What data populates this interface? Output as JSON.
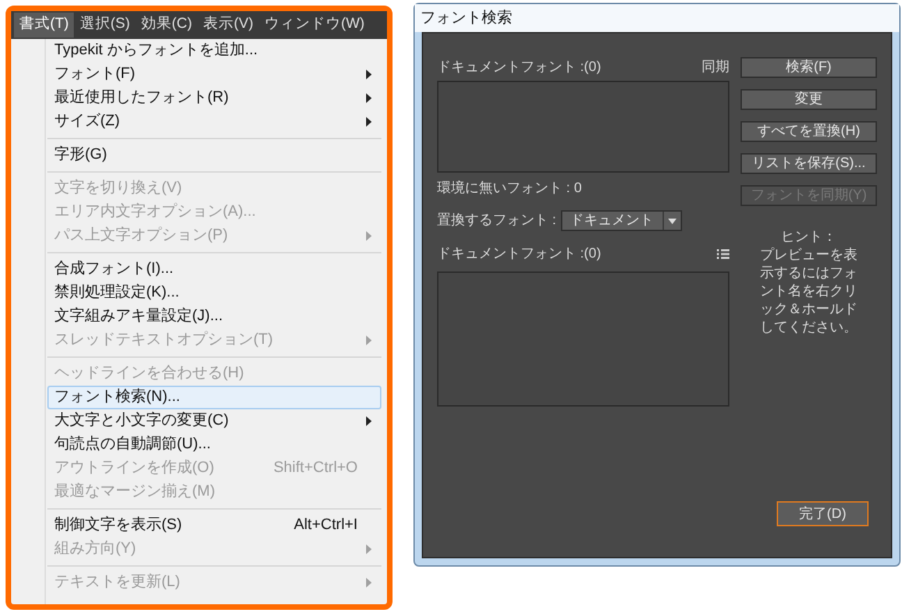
{
  "menu_bar": [
    {
      "label": "書式(T)",
      "selected": true
    },
    {
      "label": "選択(S)",
      "selected": false
    },
    {
      "label": "効果(C)",
      "selected": false
    },
    {
      "label": "表示(V)",
      "selected": false
    },
    {
      "label": "ウィンドウ(W)",
      "selected": false
    }
  ],
  "menu": [
    {
      "kind": "item",
      "label": "Typekit からフォントを追加...",
      "disabled": false,
      "submenu": false,
      "selected": false
    },
    {
      "kind": "item",
      "label": "フォント(F)",
      "disabled": false,
      "submenu": true,
      "selected": false
    },
    {
      "kind": "item",
      "label": "最近使用したフォント(R)",
      "disabled": false,
      "submenu": true,
      "selected": false
    },
    {
      "kind": "item",
      "label": "サイズ(Z)",
      "disabled": false,
      "submenu": true,
      "selected": false
    },
    {
      "kind": "separator"
    },
    {
      "kind": "item",
      "label": "字形(G)",
      "disabled": false,
      "submenu": false,
      "selected": false
    },
    {
      "kind": "separator"
    },
    {
      "kind": "item",
      "label": "文字を切り換え(V)",
      "disabled": true,
      "submenu": false,
      "selected": false
    },
    {
      "kind": "item",
      "label": "エリア内文字オプション(A)...",
      "disabled": true,
      "submenu": false,
      "selected": false
    },
    {
      "kind": "item",
      "label": "パス上文字オプション(P)",
      "disabled": true,
      "submenu": true,
      "selected": false
    },
    {
      "kind": "separator"
    },
    {
      "kind": "item",
      "label": "合成フォント(I)...",
      "disabled": false,
      "submenu": false,
      "selected": false
    },
    {
      "kind": "item",
      "label": "禁則処理設定(K)...",
      "disabled": false,
      "submenu": false,
      "selected": false
    },
    {
      "kind": "item",
      "label": "文字組みアキ量設定(J)...",
      "disabled": false,
      "submenu": false,
      "selected": false
    },
    {
      "kind": "item",
      "label": "スレッドテキストオプション(T)",
      "disabled": true,
      "submenu": true,
      "selected": false
    },
    {
      "kind": "separator"
    },
    {
      "kind": "item",
      "label": "ヘッドラインを合わせる(H)",
      "disabled": true,
      "submenu": false,
      "selected": false
    },
    {
      "kind": "item",
      "label": "フォント検索(N)...",
      "disabled": false,
      "submenu": false,
      "selected": true
    },
    {
      "kind": "item",
      "label": "大文字と小文字の変更(C)",
      "disabled": false,
      "submenu": true,
      "selected": false
    },
    {
      "kind": "item",
      "label": "句読点の自動調節(U)...",
      "disabled": false,
      "submenu": false,
      "selected": false
    },
    {
      "kind": "item",
      "label": "アウトラインを作成(O)",
      "disabled": true,
      "submenu": false,
      "selected": false,
      "shortcut": "Shift+Ctrl+O"
    },
    {
      "kind": "item",
      "label": "最適なマージン揃え(M)",
      "disabled": true,
      "submenu": false,
      "selected": false
    },
    {
      "kind": "separator"
    },
    {
      "kind": "item",
      "label": "制御文字を表示(S)",
      "disabled": false,
      "submenu": false,
      "selected": false,
      "shortcut": "Alt+Ctrl+I"
    },
    {
      "kind": "item",
      "label": "組み方向(Y)",
      "disabled": true,
      "submenu": true,
      "selected": false
    },
    {
      "kind": "separator"
    },
    {
      "kind": "item",
      "label": "テキストを更新(L)",
      "disabled": true,
      "submenu": true,
      "selected": false
    }
  ],
  "dialog": {
    "title": "フォント検索",
    "document_fonts_label": "ドキュメントフォント :(0)",
    "sync_label": "同期",
    "missing_fonts": "環境に無いフォント : 0",
    "replace_label": "置換するフォント :",
    "replace_dropdown": {
      "value": "ドキュメント"
    },
    "replace_fonts_label": "ドキュメントフォント :(0)",
    "buttons": [
      {
        "label": "検索(F)",
        "disabled": false,
        "focused": false
      },
      {
        "label": "変更",
        "disabled": false,
        "focused": false
      },
      {
        "label": "すべてを置換(H)",
        "disabled": false,
        "focused": false
      },
      {
        "label": "リストを保存(S)...",
        "disabled": false,
        "focused": false
      },
      {
        "label": "フォントを同期(Y)",
        "disabled": true,
        "focused": false
      }
    ],
    "hint_title": "ヒント：",
    "hint_text": "プレビューを表示するにはフォント名を右クリック＆ホールドしてください。",
    "done_button": {
      "label": "完了(D)",
      "focused": true
    }
  }
}
